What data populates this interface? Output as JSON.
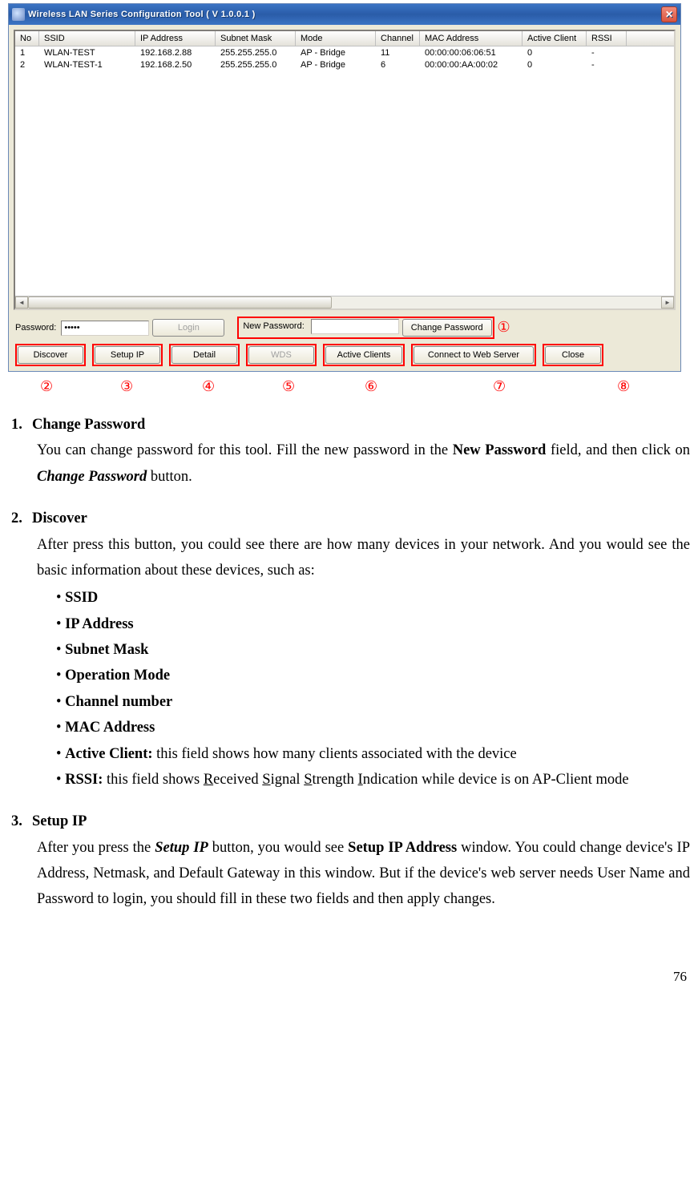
{
  "window": {
    "title": "Wireless LAN Series Configuration Tool ( V 1.0.0.1 )",
    "grid": {
      "headers": [
        "No",
        "SSID",
        "IP Address",
        "Subnet Mask",
        "Mode",
        "Channel",
        "MAC Address",
        "Active Client",
        "RSSI"
      ],
      "rows": [
        {
          "no": "1",
          "ssid": "WLAN-TEST",
          "ip": "192.168.2.88",
          "mask": "255.255.255.0",
          "mode": "AP - Bridge",
          "ch": "11",
          "mac": "00:00:00:06:06:51",
          "ac": "0",
          "rssi": "-"
        },
        {
          "no": "2",
          "ssid": "WLAN-TEST-1",
          "ip": "192.168.2.50",
          "mask": "255.255.255.0",
          "mode": "AP - Bridge",
          "ch": "6",
          "mac": "00:00:00:AA:00:02",
          "ac": "0",
          "rssi": "-"
        }
      ]
    },
    "password_label": "Password:",
    "password_value": "*****",
    "login_btn": "Login",
    "new_password_label": "New Password:",
    "change_password_btn": "Change Password",
    "buttons": {
      "discover": "Discover",
      "setup_ip": "Setup IP",
      "detail": "Detail",
      "wds": "WDS",
      "active_clients": "Active Clients",
      "connect_web": "Connect to Web Server",
      "close": "Close"
    }
  },
  "annotations": {
    "circled": [
      "①",
      "②",
      "③",
      "④",
      "⑤",
      "⑥",
      "⑦",
      "⑧"
    ]
  },
  "doc": {
    "s1": {
      "num": "1.",
      "title": "Change Password",
      "body_pre": "You can change password for this tool. Fill the new password in the ",
      "bold1": "New Password",
      "body_mid": " field, and then click on ",
      "bi1": "Change Password",
      "body_post": " button."
    },
    "s2": {
      "num": "2.",
      "title": "Discover",
      "body": "After press this button, you could see there are how many devices in your network. And you would see the basic information about these devices, such as:",
      "bullets_simple": [
        "SSID",
        "IP Address",
        "Subnet Mask",
        "Operation Mode",
        "Channel number",
        "MAC Address"
      ],
      "bullet_ac_b": "Active Client:",
      "bullet_ac_rest": " this field shows how many clients associated with the device",
      "bullet_rssi_b": "RSSI:",
      "bullet_rssi_pre": " this field shows ",
      "r_u": "R",
      "r_rest": "eceived ",
      "s_u": "S",
      "s_rest": "ignal ",
      "st_u": "S",
      "st_rest": "trength ",
      "i_u": "I",
      "i_rest": "ndication while device is on AP-Client mode"
    },
    "s3": {
      "num": "3.",
      "title": "Setup IP",
      "body_pre": "After you press the ",
      "bi1": "Setup IP",
      "body_mid": " button, you would see ",
      "b1": "Setup IP Address",
      "body_post": " window. You could change device's IP Address, Netmask, and Default Gateway in this window. But if the device's web server needs User Name and Password to login, you should fill in these two fields and then apply changes."
    },
    "page": "76"
  }
}
